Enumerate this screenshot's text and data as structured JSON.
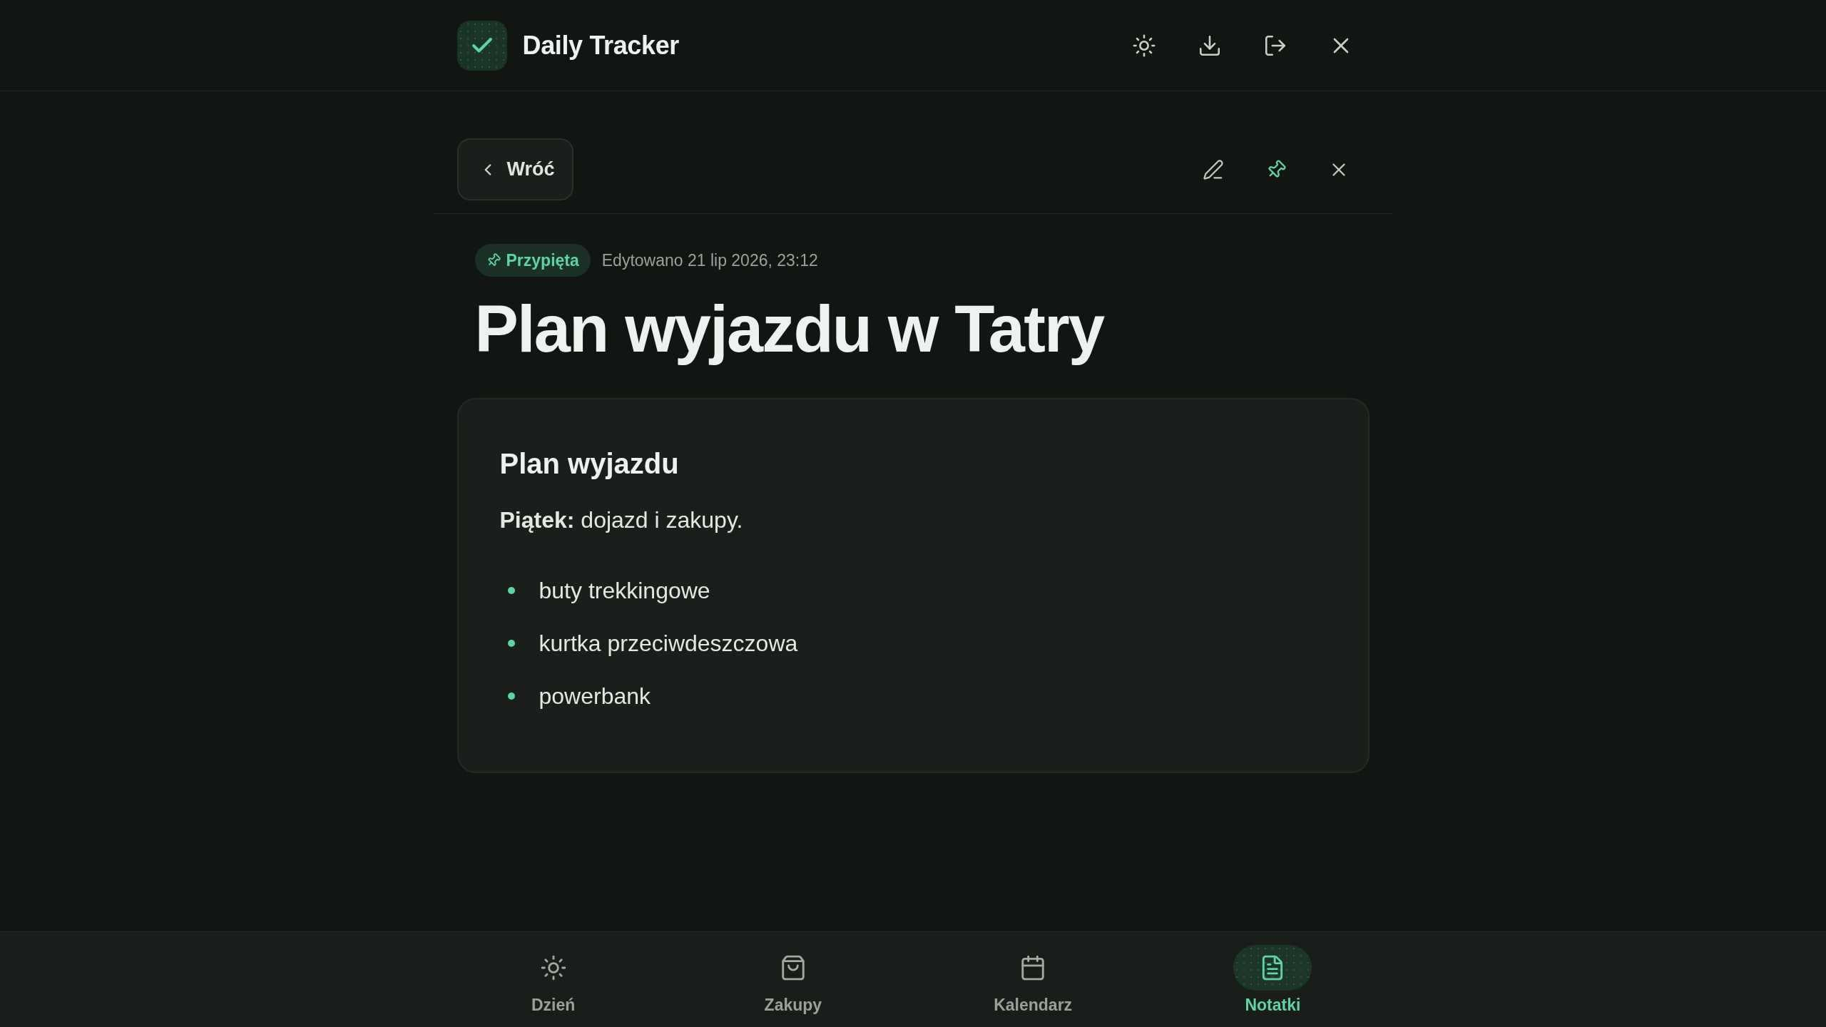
{
  "app": {
    "title": "Daily Tracker"
  },
  "note_toolbar": {
    "back_label": "Wróć"
  },
  "note": {
    "pinned": true,
    "pinned_label": "Przypięta",
    "edited": "Edytowano 21 lip 2026, 23:12",
    "title": "Plan wyjazdu w Tatry",
    "content": {
      "heading": "Plan wyjazdu",
      "paragraph": "**Piątek:** dojazd i zakupy.",
      "bullets": [
        "buty trekkingowe",
        "kurtka przeciwdeszczowa",
        "powerbank"
      ]
    }
  },
  "bottom_nav": [
    {
      "label": "Dzień",
      "selected": false
    },
    {
      "label": "Zakupy",
      "selected": false
    },
    {
      "label": "Kalendarz",
      "selected": false
    },
    {
      "label": "Notatki",
      "selected": true
    }
  ]
}
